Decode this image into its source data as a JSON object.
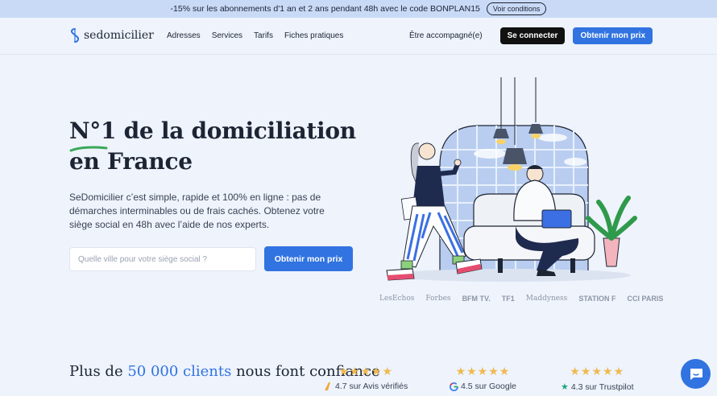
{
  "promo": {
    "text": "-15% sur les abonnements d'1 an et 2 ans pendant 48h avec le code BONPLAN15",
    "button": "Voir conditions"
  },
  "header": {
    "logo": "sedomicilier",
    "nav": [
      "Adresses",
      "Services",
      "Tarifs",
      "Fiches pratiques"
    ],
    "accompany_link": "Être accompagné(e)",
    "login_button": "Se connecter",
    "cta_button": "Obtenir mon prix"
  },
  "hero": {
    "title_line1": "N°1 de la domiciliation",
    "title_line2": "en France",
    "description": "SeDomicilier c’est simple, rapide et 100% en ligne : pas de démarches interminables ou de frais cachés. Obtenez votre siège social en 48h avec l’aide de nos experts.",
    "search_placeholder": "Quelle ville pour votre siège social ?",
    "search_button": "Obtenir mon prix"
  },
  "press": [
    "LesEchos",
    "Forbes",
    "BFM TV.",
    "TF1",
    "Maddyness",
    "STATION F",
    "CCI PARIS"
  ],
  "social_proof": {
    "prefix": "Plus de ",
    "highlight": "50 000 clients",
    "suffix": " nous font confiance"
  },
  "ratings": [
    {
      "stars": "★★★★★",
      "text": "4.7 sur Avis vérifiés",
      "icon": "avis-verifies-icon"
    },
    {
      "stars": "★★★★★",
      "text": "4.5 sur Google",
      "icon": "google-icon"
    },
    {
      "stars": "★★★★★",
      "text": "4.3 sur Trustpilot",
      "icon": "trustpilot-star-icon"
    }
  ],
  "colors": {
    "accent": "#3173e0",
    "background": "#eef3fc",
    "promo_bar": "#c9daf7",
    "star": "#f0b94f"
  }
}
